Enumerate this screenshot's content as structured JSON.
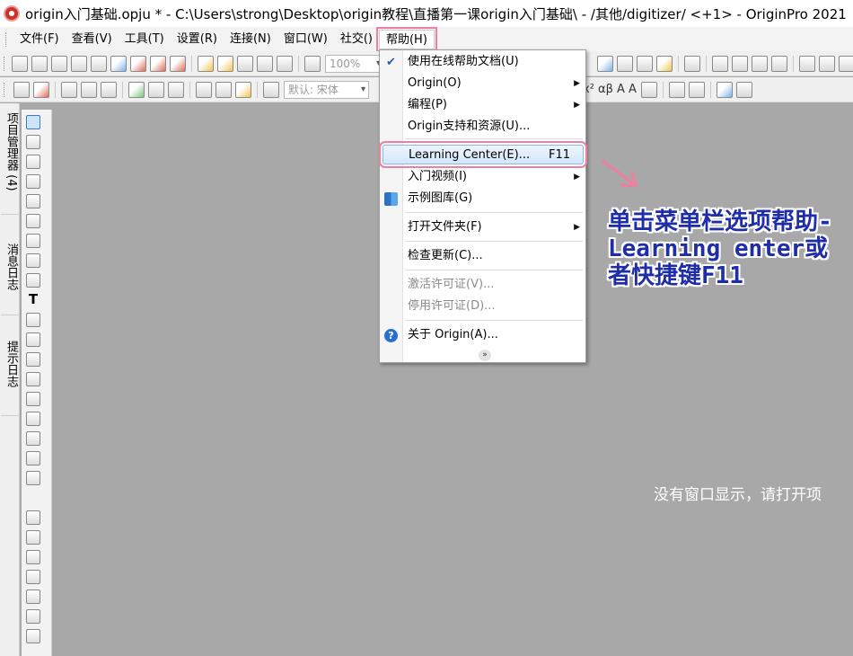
{
  "window": {
    "title": "origin入门基础.opju * - C:\\Users\\strong\\Desktop\\origin教程\\直播第一课origin入门基础\\ - /其他/digitizer/ <+1> - OriginPro 2021"
  },
  "menubar": {
    "items": [
      "文件(F)",
      "查看(V)",
      "工具(T)",
      "设置(R)",
      "连接(N)",
      "窗口(W)",
      "社交()",
      "帮助(H)"
    ]
  },
  "toolbar": {
    "zoom": "100%",
    "font": "默认: 宋体",
    "text_style": "x² αβ A A"
  },
  "side_panel": {
    "tabs": [
      "项目管理器 (4)",
      "消息日志",
      "提示日志"
    ]
  },
  "help_menu": {
    "items": [
      {
        "label": "使用在线帮助文档(U)"
      },
      {
        "label": "Origin(O)"
      },
      {
        "label": "编程(P)"
      },
      {
        "label": "Origin支持和资源(U)..."
      },
      {
        "label": "Learning Center(E)...",
        "shortcut": "F11"
      },
      {
        "label": "入门视频(I)"
      },
      {
        "label": "示例图库(G)"
      },
      {
        "label": "打开文件夹(F)"
      },
      {
        "label": "检查更新(C)..."
      },
      {
        "label": "激活许可证(V)..."
      },
      {
        "label": "停用许可证(D)..."
      },
      {
        "label": "关于 Origin(A)..."
      }
    ]
  },
  "annotation": {
    "text": "单击菜单栏选项帮助-Learning enter或者快捷键F11"
  },
  "workspace": {
    "empty_message": "没有窗口显示，请打开项"
  },
  "colors": {
    "highlight_outline": "#ef7fa0",
    "annotation_text": "#1f2ea8",
    "workspace_bg": "#a8a8a8"
  }
}
